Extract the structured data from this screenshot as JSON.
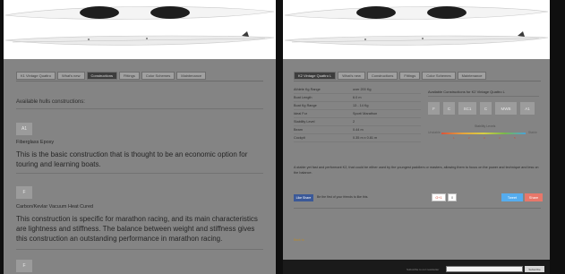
{
  "left": {
    "tabs": [
      {
        "label": "K1 Vintage Quattro",
        "active": false
      },
      {
        "label": "What's new",
        "active": false
      },
      {
        "label": "Constructions",
        "active": true
      },
      {
        "label": "Fittings",
        "active": false
      },
      {
        "label": "Color Schemes",
        "active": false
      },
      {
        "label": "Maintenance",
        "active": false
      }
    ],
    "intro": "Available hulls constructions:",
    "constructions": [
      {
        "code": "A1",
        "title": "Fiberglass Epoxy",
        "description": "This is the basic construction that is thought to be an economic option for touring and learning boats."
      },
      {
        "code": "F",
        "title": "Carbon/Kevlar Vacuum Heat Cured",
        "description": "This construction is specific for marathon racing, and its main characteristics are lightness and stiffness. The balance between weight and stiffness gives this construction an outstanding performance in marathon racing."
      },
      {
        "code": "F"
      }
    ]
  },
  "right": {
    "tabs": [
      {
        "label": "K2 Vintage Quattro L",
        "active": true
      },
      {
        "label": "What's new",
        "active": false
      },
      {
        "label": "Constructions",
        "active": false
      },
      {
        "label": "Fittings",
        "active": false
      },
      {
        "label": "Color Schemes",
        "active": false
      },
      {
        "label": "Maintenance",
        "active": false
      }
    ],
    "specs": [
      {
        "k": "Athlete Kg Range",
        "v": "over 200 Kg"
      },
      {
        "k": "Boat Length",
        "v": "6.0 m"
      },
      {
        "k": "Boat Kg Range",
        "v": "13 - 14 Kg"
      },
      {
        "k": "Ideal For",
        "v": "Sport/ Marathon"
      },
      {
        "k": "Stability Level",
        "v": "2"
      },
      {
        "k": "Beam",
        "v": "0.44 m"
      },
      {
        "k": "Cockpit",
        "v": "0.35 m x 0.81 m"
      }
    ],
    "available_label": "Available Constructions for K2 Vintage Quattro L",
    "construction_codes": [
      "F",
      "C",
      "SC1",
      "C",
      "MWB",
      "A1"
    ],
    "stability": {
      "label": "Stability Levels",
      "left": "Unstable",
      "right": "Stable",
      "levels": [
        "1",
        "2",
        "3",
        "4",
        "5"
      ]
    },
    "description": "A stable yet fast and performant K2, that could be either used by the youngest paddlers or masters, allowing them to focus on the power and technique and less on the balance.",
    "facebook": {
      "button": "Like Share",
      "text": "Be the first of your friends to like this."
    },
    "gplus": {
      "label": "G+1",
      "count": "0"
    },
    "tweet": "Tweet",
    "share": "Share",
    "link": "Back to",
    "footer_label": "Subscribe to our newsletter",
    "footer_button": "Subscribe"
  },
  "colors": {
    "panel": "#848484",
    "active_tab": "#3d3d3d",
    "facebook": "#3b5998",
    "twitter": "#55acee",
    "share": "#e8776a"
  }
}
